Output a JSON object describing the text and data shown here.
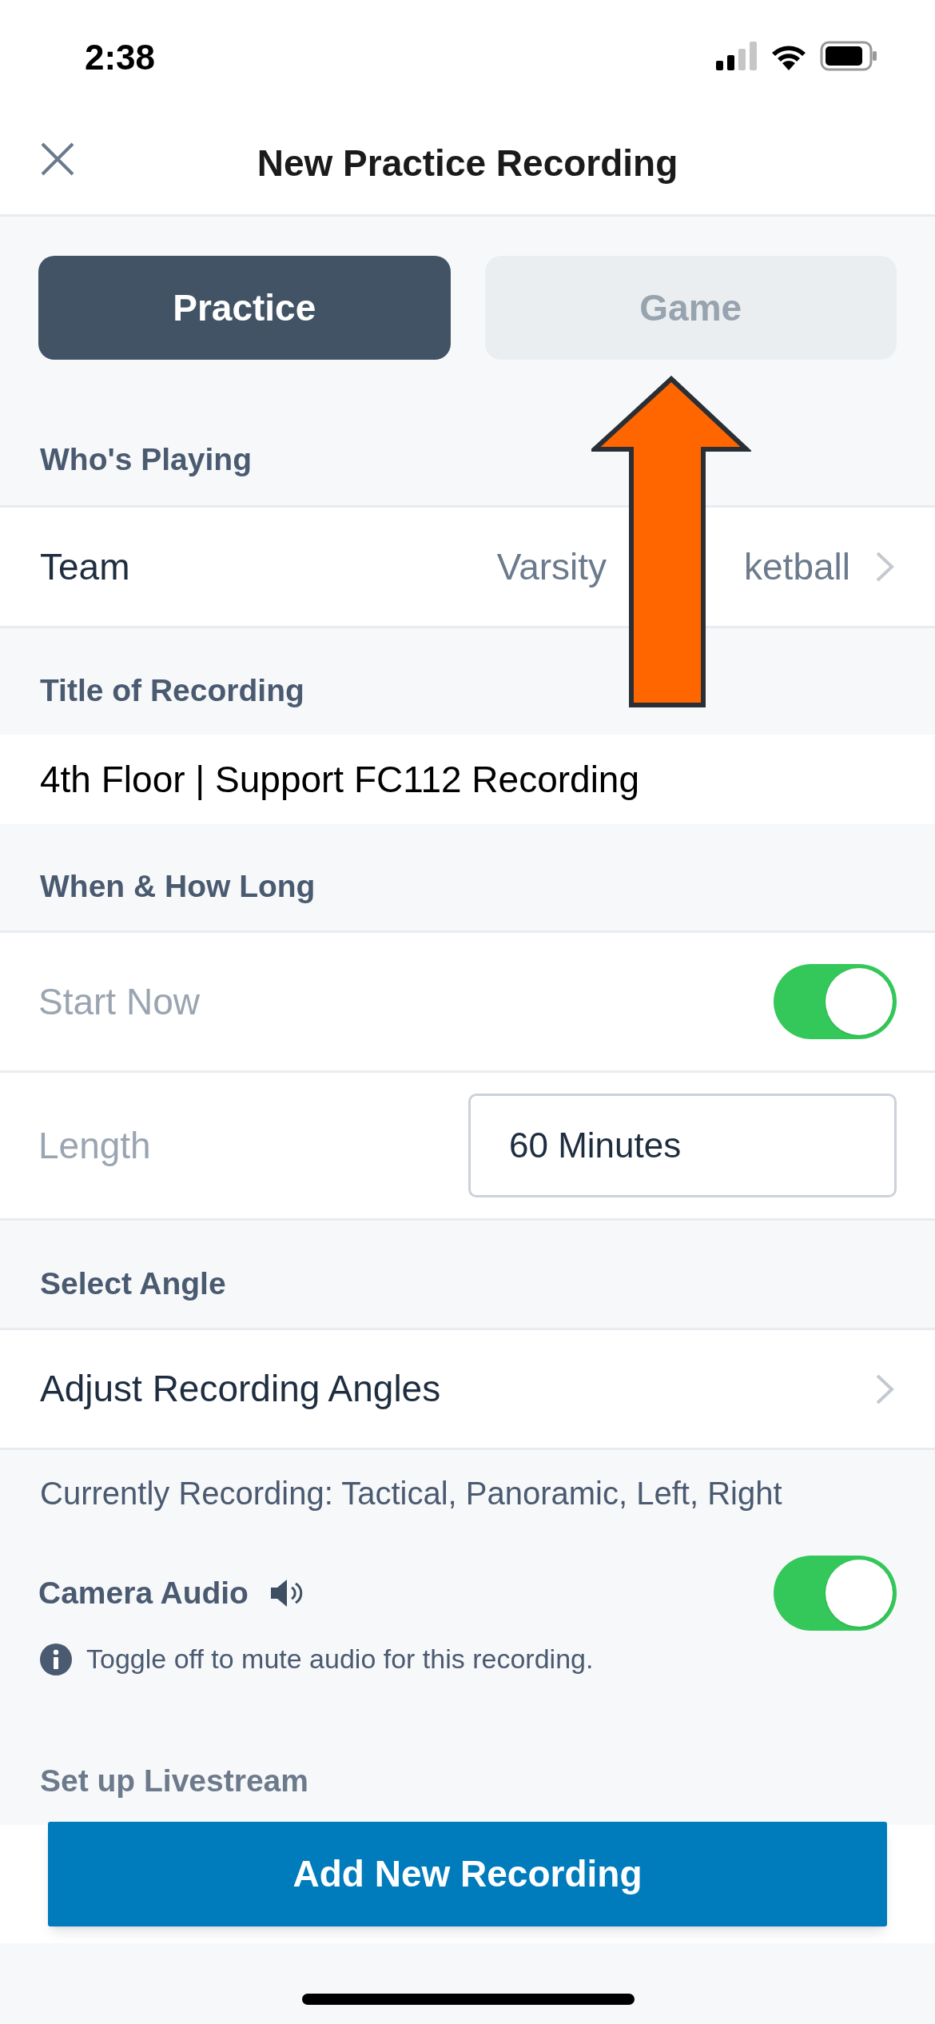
{
  "status_bar": {
    "time": "2:38"
  },
  "header": {
    "title": "New Practice Recording"
  },
  "segments": [
    {
      "label": "Practice",
      "selected": true
    },
    {
      "label": "Game",
      "selected": false
    }
  ],
  "who_playing": {
    "heading": "Who's Playing",
    "label": "Team",
    "value_parts": [
      "Varsity",
      "ketball"
    ]
  },
  "title_section": {
    "heading": "Title of Recording",
    "value": "4th Floor | Support FC112 Recording"
  },
  "when": {
    "heading": "When & How Long",
    "start_now": {
      "label": "Start Now",
      "on": true
    },
    "length": {
      "label": "Length",
      "value": "60 Minutes"
    }
  },
  "angle": {
    "heading": "Select Angle",
    "row": "Adjust Recording Angles",
    "current": "Currently Recording: Tactical, Panoramic, Left, Right"
  },
  "camera_audio": {
    "label": "Camera Audio",
    "on": true,
    "hint": "Toggle off to mute audio for this recording."
  },
  "livestream": {
    "heading": "Set up Livestream"
  },
  "submit": {
    "label": "Add New Recording"
  }
}
